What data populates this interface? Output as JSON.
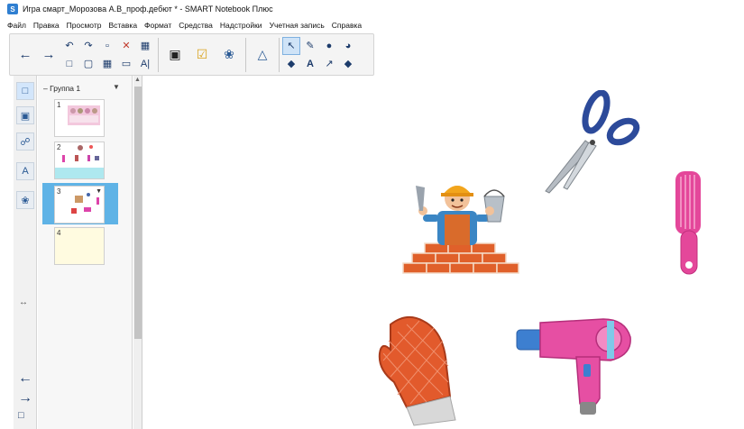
{
  "window": {
    "title": "Игра смарт_Морозова А.В_проф.дебют * - SMART Notebook Плюс",
    "app_icon": "smart-notebook-icon"
  },
  "menu": [
    "Файл",
    "Правка",
    "Просмотр",
    "Вставка",
    "Формат",
    "Средства",
    "Надстройки",
    "Учетная запись",
    "Справка"
  ],
  "sorter": {
    "group_label": "Группа 1",
    "pages": [
      {
        "number": "1"
      },
      {
        "number": "2"
      },
      {
        "number": "3",
        "selected": true
      },
      {
        "number": "4"
      }
    ]
  },
  "canvas": {
    "objects": [
      "builder",
      "scissors",
      "comb",
      "oven-mitt",
      "hair-dryer"
    ]
  },
  "colors": {
    "selection": "#5fb3e6",
    "toolbar_bg": "#f4f4f4",
    "page4_bg": "#fffbe0"
  }
}
